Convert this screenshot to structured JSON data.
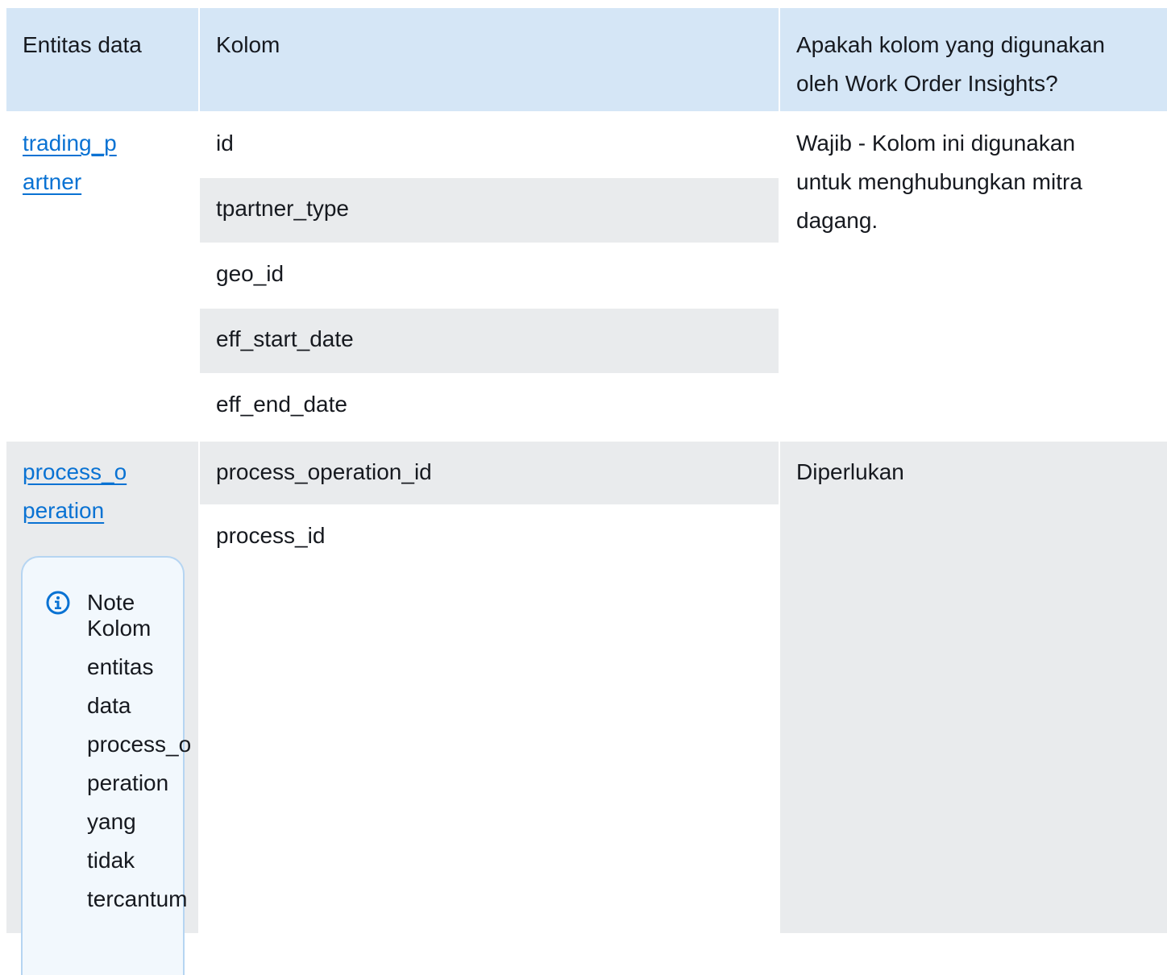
{
  "table": {
    "headers": [
      "Entitas data",
      "Kolom",
      "Apakah kolom yang digunakan oleh Work Order Insights?"
    ],
    "rows": [
      {
        "entity_lines": [
          "trading_p",
          "artner"
        ],
        "columns": [
          "id",
          "tpartner_type",
          "geo_id",
          "eff_start_date",
          "eff_end_date"
        ],
        "usage": "Wajib - Kolom ini digunakan untuk menghubungkan mitra dagang."
      },
      {
        "entity_lines": [
          "process_o",
          "peration"
        ],
        "columns": [
          "process_operation_id",
          "process_id"
        ],
        "usage": "Diperlukan",
        "note": {
          "title": "Note",
          "body_lines": [
            "Kolom",
            "entitas",
            "data",
            "process_o",
            "peration",
            "yang",
            "tidak",
            "tercantum"
          ]
        }
      }
    ]
  },
  "colors": {
    "header_bg": "#d5e6f6",
    "stripe_bg": "#e9ebed",
    "link": "#0972d3",
    "note_bg": "#f2f8fd",
    "note_border": "#b6d5f2"
  },
  "icons": {
    "note": "info-circle-icon"
  }
}
